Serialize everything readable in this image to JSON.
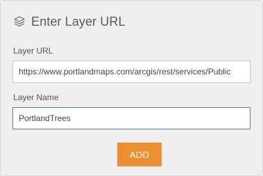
{
  "dialog": {
    "title": "Enter Layer URL",
    "header_icon": "layers-icon"
  },
  "fields": {
    "url_label": "Layer URL",
    "url_value": "https://www.portlandmaps.com/arcgis/rest/services/Public",
    "name_label": "Layer Name",
    "name_value": "PortlandTrees"
  },
  "actions": {
    "add_label": "ADD"
  },
  "colors": {
    "accent": "#ec8f31",
    "focus_border": "#4a7bb7",
    "panel_bg": "#efefef"
  }
}
